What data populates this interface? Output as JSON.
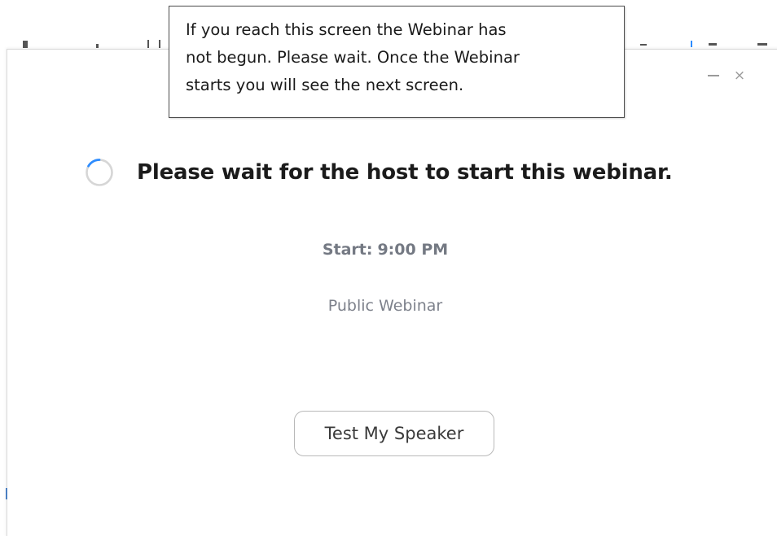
{
  "tooltip": {
    "lines": [
      "If you reach this screen the Webinar has",
      "not begun. Please wait. Once the Webinar",
      "starts you will see the next screen."
    ]
  },
  "window_controls": {
    "minimize_icon": "minimize-icon",
    "close_icon": "close-icon",
    "close_glyph": "×"
  },
  "main": {
    "spinner_icon": "loading-spinner-icon",
    "heading": "Please wait for the host to start this webinar.",
    "start_label": "Start:",
    "start_time": "9:00 PM",
    "webinar_type": "Public Webinar",
    "test_speaker_label": "Test My Speaker"
  },
  "colors": {
    "spinner_accent": "#2d8cff",
    "spinner_track": "#d6d6d6",
    "muted_text": "#747983"
  }
}
